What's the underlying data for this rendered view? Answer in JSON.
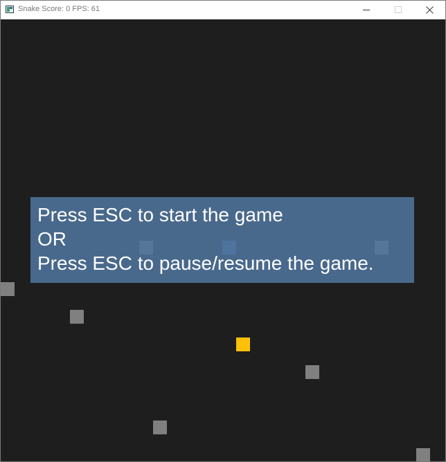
{
  "window": {
    "title": "Snake Score: 0 FPS: 61",
    "icon": "app-icon"
  },
  "controls": {
    "minimize_icon": "minimize-icon",
    "maximize_icon": "maximize-icon",
    "close_icon": "close-icon"
  },
  "game": {
    "score": 0,
    "fps": 61,
    "background_color": "#1e1e1e",
    "obstacle_color": "#808080",
    "food_color": "#ffc107",
    "overlay_color": "#50749c"
  },
  "overlay": {
    "line1": "Press ESC to start the game",
    "line2": "OR",
    "line3": "Press ESC to pause/resume the game."
  }
}
